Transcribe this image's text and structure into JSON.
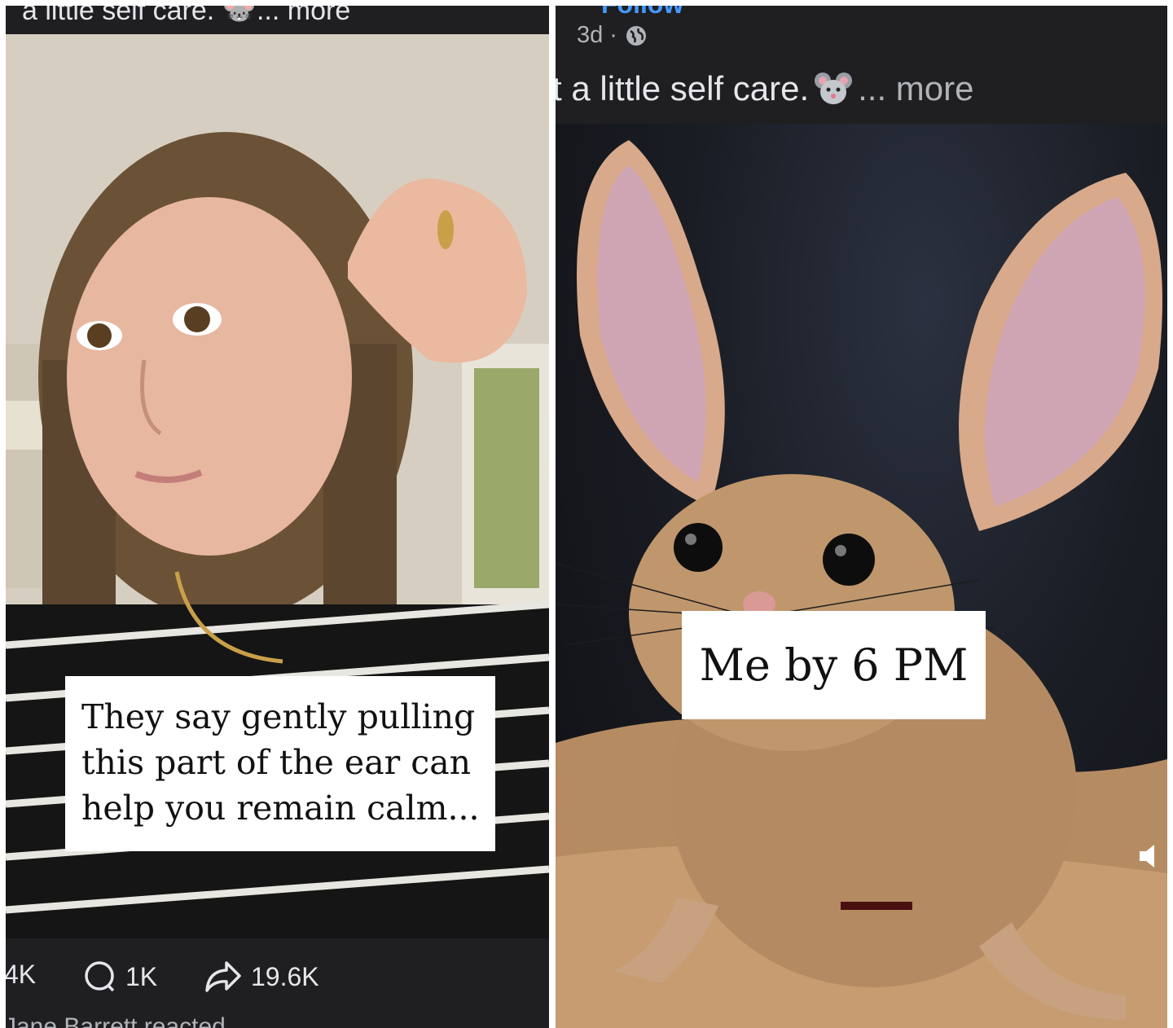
{
  "left_post": {
    "caption_top": "a little self care. 🐭... more",
    "overlay_text": "They say gently pulling this part of the ear can help you remain calm...",
    "actions": {
      "likes": "4K",
      "comments": "1K",
      "shares": "19.6K"
    },
    "reacted_line": "Jane Barrett reacted"
  },
  "right_post": {
    "follow_label": "Follow",
    "time": "3d",
    "separator": "·",
    "audience_icon": "globe-icon",
    "text": "t a little self care.",
    "more_label": "... more",
    "overlay_text": "Me by 6 PM",
    "volume_icon": "volume-icon"
  },
  "colors": {
    "panel_bg": "#1f1f22",
    "text_primary": "#e4e6eb",
    "text_secondary": "#b0b3b8",
    "link_blue": "#4599ff"
  }
}
